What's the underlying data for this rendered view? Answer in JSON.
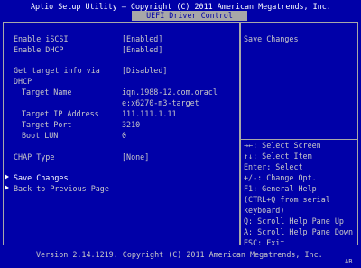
{
  "header": {
    "title": "Aptio Setup Utility – Copyright (C) 2011 American Megatrends, Inc.",
    "tab": "UEFI Driver Control"
  },
  "settings": [
    {
      "label": "Enable iSCSI",
      "value": "[Enabled]"
    },
    {
      "label": "Enable DHCP",
      "value": "[Enabled]"
    },
    {
      "label": "Get target info via",
      "label2": "DHCP",
      "value": "[Disabled]"
    },
    {
      "label": "Target Name",
      "value": "iqn.1988-12.com.oracl",
      "value2": "e:x6270-m3-target"
    },
    {
      "label": "Target IP Address",
      "value": "111.111.1.11"
    },
    {
      "label": "Target Port",
      "value": "3210"
    },
    {
      "label": "Boot LUN",
      "value": "0"
    },
    {
      "label": "CHAP Type",
      "value": "[None]"
    }
  ],
  "actions": [
    {
      "label": "Save Changes"
    },
    {
      "label": "Back to Previous Page"
    }
  ],
  "help": {
    "description": "Save Changes",
    "keys": [
      "→←: Select Screen",
      "↑↓: Select Item",
      "Enter: Select",
      "+/-: Change Opt.",
      "F1: General Help",
      "(CTRL+Q from serial",
      "keyboard)",
      "Q: Scroll Help Pane Up",
      "A: Scroll Help Pane Down",
      "ESC: Exit"
    ]
  },
  "footer": {
    "version": "Version 2.14.1219. Copyright (C) 2011 American Megatrends, Inc.",
    "badge": "AB"
  }
}
